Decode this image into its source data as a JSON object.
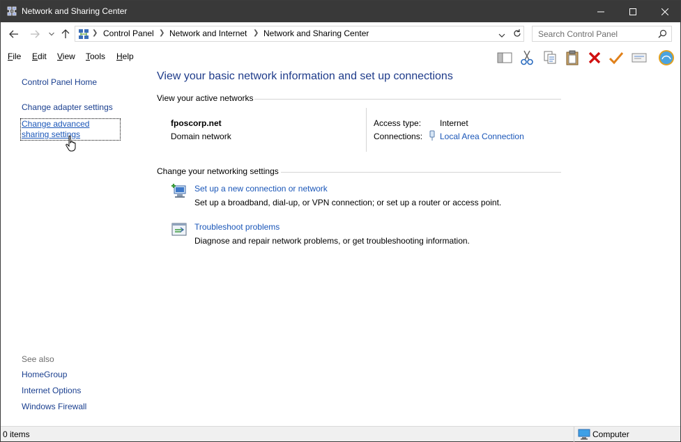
{
  "window": {
    "title": "Network and Sharing Center",
    "icon": "network-center-icon",
    "controls": [
      "minimize",
      "maximize",
      "close"
    ]
  },
  "address": {
    "breadcrumbs": [
      "Control Panel",
      "Network and Internet",
      "Network and Sharing Center"
    ],
    "search_placeholder": "Search Control Panel"
  },
  "menu": {
    "items": [
      {
        "label_u": "F",
        "label_rest": "ile"
      },
      {
        "label_u": "E",
        "label_rest": "dit"
      },
      {
        "label_u": "V",
        "label_rest": "iew"
      },
      {
        "label_u": "T",
        "label_rest": "ools"
      },
      {
        "label_u": "H",
        "label_rest": "elp"
      }
    ],
    "toolbar_icons": [
      "layout-icon",
      "cut-icon",
      "copy-icon",
      "paste-icon",
      "delete-icon",
      "check-icon",
      "properties-icon",
      "shell-icon"
    ]
  },
  "sidebar": {
    "home": "Control Panel Home",
    "links": [
      "Change adapter settings",
      "Change advanced sharing settings"
    ],
    "see_also_label": "See also",
    "see_also": [
      "HomeGroup",
      "Internet Options",
      "Windows Firewall"
    ]
  },
  "main": {
    "title": "View your basic network information and set up connections",
    "active_networks_header": "View your active networks",
    "network": {
      "name": "fposcorp.net",
      "type": "Domain network",
      "access_type_label": "Access type:",
      "access_type_value": "Internet",
      "connections_label": "Connections:",
      "connections_value": "Local Area Connection"
    },
    "settings_header": "Change your networking settings",
    "tasks": [
      {
        "link": "Set up a new connection or network",
        "desc": "Set up a broadband, dial-up, or VPN connection; or set up a router or access point."
      },
      {
        "link": "Troubleshoot problems",
        "desc": "Diagnose and repair network problems, or get troubleshooting information."
      }
    ]
  },
  "status": {
    "items": "0 items",
    "zone": "Computer"
  },
  "colors": {
    "title_bar": "#393939",
    "link": "#1a56b8",
    "heading": "#1e3b8a"
  }
}
